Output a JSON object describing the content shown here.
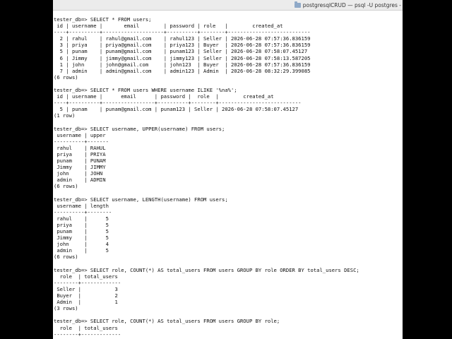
{
  "window": {
    "title": "postgresqlCRUD — psql -U postgres -"
  },
  "terminal": {
    "lines": [
      "tester_db=> SELECT * FROM users;",
      " id | username |       email        | password | role   |        created_at",
      "----+----------+--------------------+----------+--------+---------------------------",
      "  2 | rahul    | rahul@gmail.com    | rahul123 | Seller | 2026-06-28 07:57:36.836159",
      "  3 | priya    | priya@gmail.com    | priya123 | Buyer  | 2026-06-28 07:57:36.836159",
      "  5 | punam    | punam@gmail.com    | punam123 | Seller | 2026-06-28 07:58:07.45127",
      "  6 | Jimmy    | jimmy@gmail.com    | jimmy123 | Seller | 2026-06-28 07:58:13.587205",
      "  1 | john     | john@gmail.com     | john123  | Buyer  | 2026-06-28 07:57:36.836159",
      "  7 | admin    | admin@gmail.com    | admin123 | Admin  | 2026-06-28 08:32:29.399085",
      "(6 rows)",
      "",
      "tester_db=> SELECT * FROM users WHERE username ILIKE '%na%';",
      " id | username |      email      | password |  role  |        created_at",
      "----+----------+-----------------+----------+--------+---------------------------",
      "  5 | punam    | punam@gmail.com | punam123 | Seller | 2026-06-28 07:58:07.45127",
      "(1 row)",
      "",
      "tester_db=> SELECT username, UPPER(username) FROM users;",
      " username | upper",
      "----------+-------",
      " rahul    | RAHUL",
      " priya    | PRIYA",
      " punam    | PUNAM",
      " Jimmy    | JIMMY",
      " john     | JOHN",
      " admin    | ADMIN",
      "(6 rows)",
      "",
      "tester_db=> SELECT username, LENGTH(username) FROM users;",
      " username | length",
      "----------+--------",
      " rahul    |      5",
      " priya    |      5",
      " punam    |      5",
      " Jimmy    |      5",
      " john     |      4",
      " admin    |      5",
      "(6 rows)",
      "",
      "tester_db=> SELECT role, COUNT(*) AS total_users FROM users GROUP BY role ORDER BY total_users DESC;",
      "  role  | total_users",
      "--------+-------------",
      " Seller |           3",
      " Buyer  |           2",
      " Admin  |           1",
      "(3 rows)",
      "",
      "tester_db=> SELECT role, COUNT(*) AS total_users FROM users GROUP BY role;",
      "  role  | total_users",
      "--------+-------------"
    ]
  }
}
